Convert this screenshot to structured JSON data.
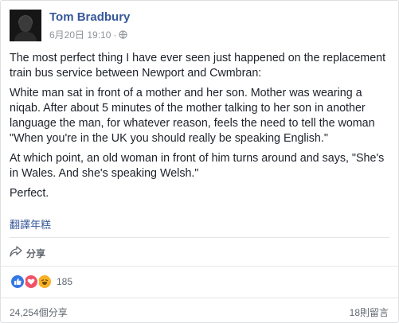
{
  "post": {
    "author": "Tom Bradbury",
    "timestamp": "6月20日 19:10",
    "separator": "·",
    "paragraphs": [
      "The most perfect thing I have ever seen just happened on the replacement train bus service between Newport and Cwmbran:",
      "White man sat in front of a mother and her son. Mother was wearing a niqab. After about 5 minutes of the mother talking to her son in another language the man, for whatever reason, feels the need to tell the woman \"When you're in the UK you should really be speaking English.\"",
      "At which point, an old woman in front of him turns around and says, \"She's in Wales. And she's speaking Welsh.\"",
      "Perfect."
    ],
    "translate_label": "翻譯年糕"
  },
  "actions": {
    "share_label": "分享",
    "share_icon": "share-arrow-icon"
  },
  "reactions": {
    "icons": [
      "like-icon",
      "love-icon",
      "haha-icon"
    ],
    "count": "185"
  },
  "footer": {
    "shares": "24,254個分享",
    "comments": "18則留言"
  },
  "colors": {
    "link": "#365899",
    "text": "#1d2129",
    "muted": "#90949c",
    "like": "#3578e5",
    "love": "#f25268",
    "haha": "#f7b125"
  }
}
